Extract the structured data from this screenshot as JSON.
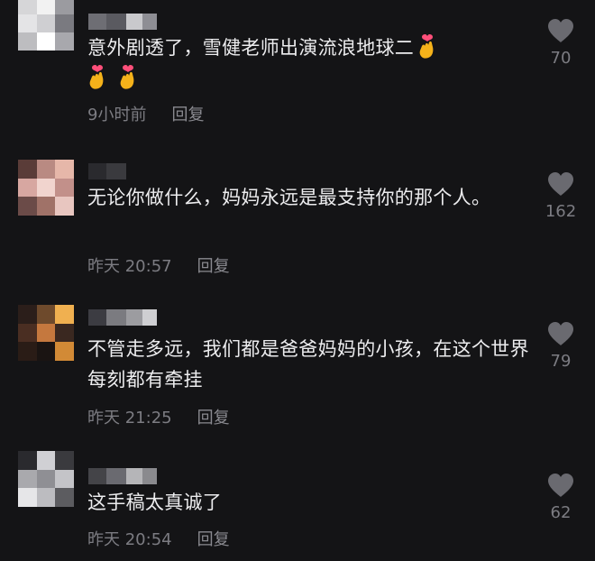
{
  "comments": [
    {
      "text": "意外剧透了，雪健老师出演流浪地球二",
      "time": "9小时前",
      "reply_label": "回复",
      "likes": "70",
      "avatar_colors": [
        "#d6d6d8",
        "#f2f2f2",
        "#9b9ba0",
        "#e4e4e6",
        "#cfcfd2",
        "#7a7a80",
        "#bdbdc0",
        "#ffffff",
        "#a8a8ad"
      ],
      "username_colors": [
        "#6e6e74",
        "#5a5a60",
        "#c9c9cc",
        "#8e8e94"
      ],
      "emoji_count": 3,
      "icon": "heart-hands-emoji"
    },
    {
      "text": "无论你做什么，妈妈永远是最支持你的那个人。",
      "time": "昨天 20:57",
      "reply_label": "回复",
      "likes": "162",
      "avatar_colors": [
        "#5a3c38",
        "#b98a82",
        "#e6b7a9",
        "#d7a7a1",
        "#f1d4ce",
        "#c2908a",
        "#6b4b48",
        "#a07268",
        "#e8c6c0"
      ],
      "username_colors": [
        "#2a2a2e",
        "#3a3a3e"
      ],
      "emoji_count": 0,
      "icon": "heart-icon"
    },
    {
      "text": "不管走多远，我们都是爸爸妈妈的小孩，在这个世界每刻都有牵挂",
      "time": "昨天 21:25",
      "reply_label": "回复",
      "likes": "79",
      "avatar_colors": [
        "#2b1e1a",
        "#6e4a2c",
        "#f0b050",
        "#4a2e22",
        "#c5783e",
        "#3a2820",
        "#2a1c16",
        "#1a1412",
        "#d28a36"
      ],
      "username_colors": [
        "#3c3c42",
        "#7b7b80",
        "#9c9ca0",
        "#cfcfd2"
      ],
      "emoji_count": 0,
      "icon": "heart-icon"
    },
    {
      "text": "这手稿太真诚了",
      "time": "昨天 20:54",
      "reply_label": "回复",
      "likes": "62",
      "avatar_colors": [
        "#2a2a2e",
        "#d0d0d4",
        "#3a3a3e",
        "#a9a9ad",
        "#8f8f94",
        "#c4c4c8",
        "#e6e6e8",
        "#bcbcc0",
        "#5c5c60"
      ],
      "username_colors": [
        "#444448",
        "#6a6a70",
        "#b5b5b8",
        "#8a8a8e"
      ],
      "emoji_count": 0,
      "icon": "heart-icon"
    }
  ]
}
